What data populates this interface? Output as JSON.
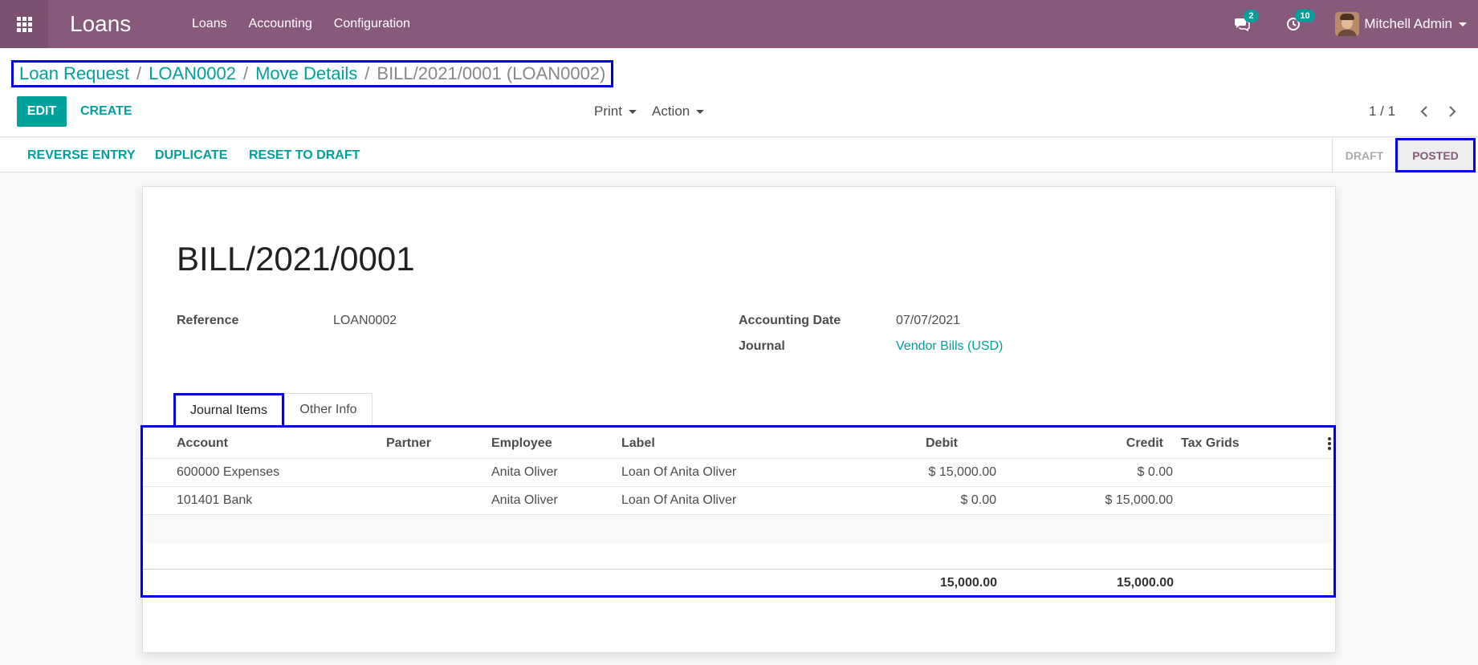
{
  "app": {
    "title": "Loans"
  },
  "nav": {
    "menu": [
      "Loans",
      "Accounting",
      "Configuration"
    ],
    "messages_count": "2",
    "activities_count": "10",
    "user_name": "Mitchell Admin"
  },
  "breadcrumb": {
    "items": [
      "Loan Request",
      "LOAN0002",
      "Move Details"
    ],
    "current": "BILL/2021/0001 (LOAN0002)"
  },
  "toolbar": {
    "edit_label": "EDIT",
    "create_label": "CREATE",
    "print_label": "Print",
    "action_label": "Action",
    "pager_value": "1 / 1"
  },
  "statusbar": {
    "buttons": [
      "REVERSE ENTRY",
      "DUPLICATE",
      "RESET TO DRAFT"
    ],
    "stages": [
      "DRAFT",
      "POSTED"
    ]
  },
  "form": {
    "title": "BILL/2021/0001",
    "reference_label": "Reference",
    "reference_value": "LOAN0002",
    "accounting_date_label": "Accounting Date",
    "accounting_date_value": "07/07/2021",
    "journal_label": "Journal",
    "journal_value": "Vendor Bills (USD)"
  },
  "tabs": [
    "Journal Items",
    "Other Info"
  ],
  "lines": {
    "headers": [
      "Account",
      "Partner",
      "Employee",
      "Label",
      "Debit",
      "Credit",
      "Tax Grids"
    ],
    "rows": [
      [
        "600000 Expenses",
        "",
        "Anita Oliver",
        "Loan Of Anita Oliver",
        "$ 15,000.00",
        "$ 0.00",
        ""
      ],
      [
        "101401 Bank",
        "",
        "Anita Oliver",
        "Loan Of Anita Oliver",
        "$ 0.00",
        "$ 15,000.00",
        ""
      ]
    ],
    "total_debit": "15,000.00",
    "total_credit": "15,000.00"
  },
  "colors": {
    "navbar": "#875a7b",
    "accent": "#00a09d",
    "highlight_border": "#0000e5"
  }
}
